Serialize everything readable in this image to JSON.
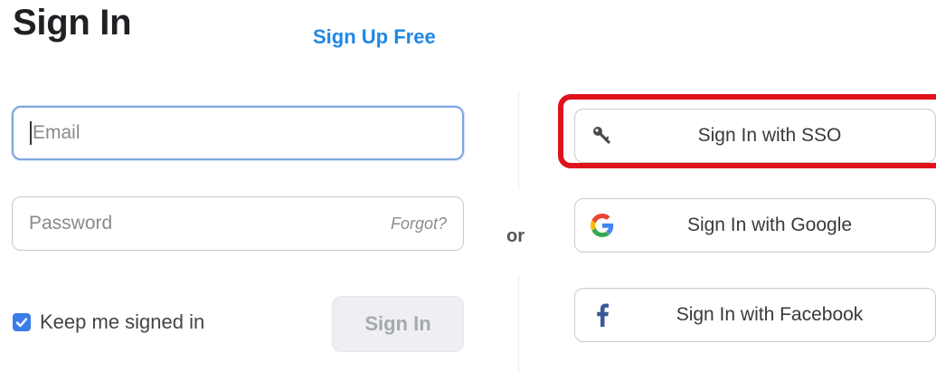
{
  "header": {
    "title": "Sign In",
    "signup_link": "Sign Up Free"
  },
  "form": {
    "email_placeholder": "Email",
    "password_placeholder": "Password",
    "forgot_link": "Forgot?",
    "keep_signed_in": "Keep me signed in",
    "keep_signed_in_checked": true,
    "signin_button": "Sign In"
  },
  "divider": {
    "or_label": "or"
  },
  "social": {
    "sso_label": "Sign In with SSO",
    "google_label": "Sign In with Google",
    "facebook_label": "Sign In with Facebook"
  },
  "colors": {
    "link": "#1e88e5",
    "checkbox": "#3b7de9",
    "highlight": "#e0121b",
    "facebook": "#3b5998"
  },
  "icons": {
    "sso": "key-icon",
    "google": "google-icon",
    "facebook": "facebook-icon"
  }
}
